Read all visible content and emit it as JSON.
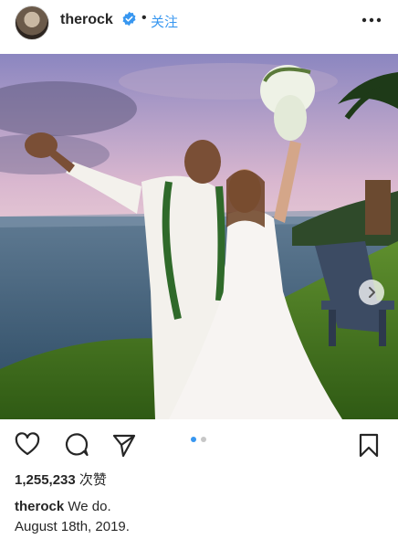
{
  "post": {
    "username": "therock",
    "separator": "•",
    "follow_label": "关注",
    "likes_count": "1,255,233",
    "likes_label": "次赞",
    "caption_user": "therock",
    "caption_line1": "We do.",
    "caption_line2": "August 18th, 2019."
  },
  "icons": {
    "verified": "verified-badge-icon",
    "more": "more-options-icon",
    "like": "heart-icon",
    "comment": "comment-icon",
    "share": "send-icon",
    "save": "bookmark-icon",
    "next": "chevron-right-icon"
  },
  "carousel": {
    "total": 2,
    "active": 1
  },
  "colors": {
    "accent": "#3897f0",
    "verified": "#3897f0",
    "text": "#262626"
  }
}
